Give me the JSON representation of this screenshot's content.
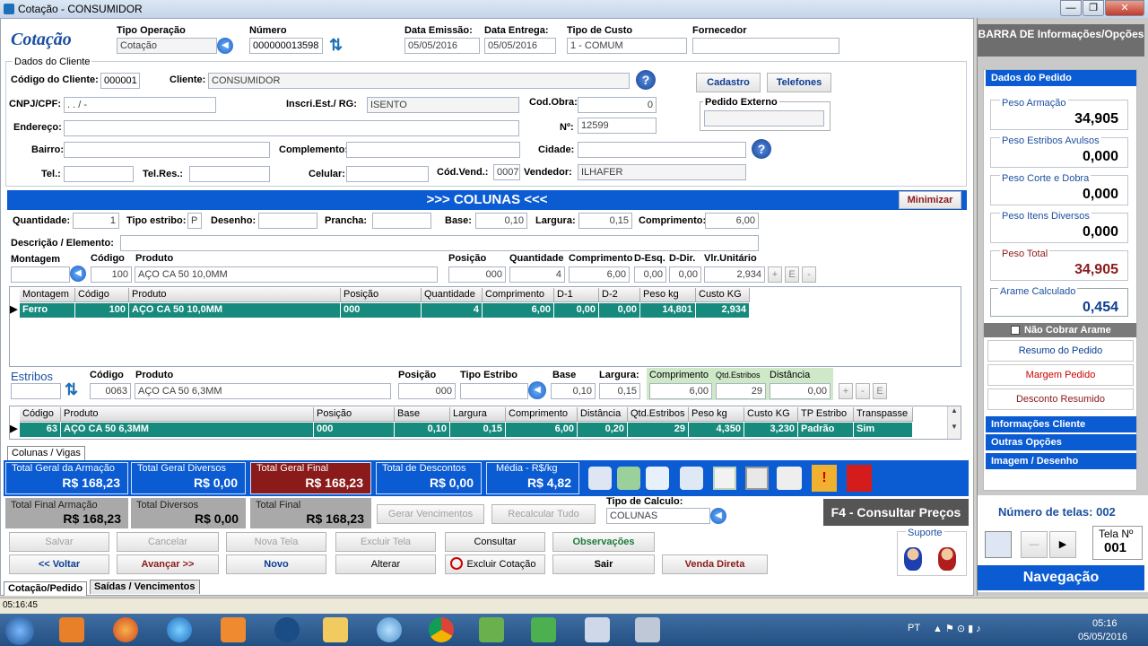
{
  "window": {
    "title": "Cotação - CONSUMIDOR"
  },
  "header": {
    "page_title": "Cotação",
    "tipo_operacao_label": "Tipo Operação",
    "tipo_operacao_value": "Cotação",
    "numero_label": "Número",
    "numero_value": "000000013598",
    "data_emissao_label": "Data Emissão:",
    "data_emissao_value": "05/05/2016",
    "data_entrega_label": "Data Entrega:",
    "data_entrega_value": "05/05/2016",
    "tipo_custo_label": "Tipo de Custo",
    "tipo_custo_value": "1 - COMUM",
    "fornecedor_label": "Fornecedor",
    "fornecedor_value": ""
  },
  "cliente": {
    "section_label": "Dados do Cliente",
    "codigo_label": "Código do Cliente:",
    "codigo_value": "000001",
    "cliente_label": "Cliente:",
    "cliente_value": "CONSUMIDOR",
    "cadastro_btn": "Cadastro",
    "telefones_btn": "Telefones",
    "cnpj_label": "CNPJ/CPF:",
    "cnpj_value": ".   .   /   -",
    "inscr_label": "Inscri.Est./ RG:",
    "inscr_value": "ISENTO",
    "codobra_label": "Cod.Obra:",
    "codobra_value": "0",
    "pedido_externo_label": "Pedido Externo",
    "endereco_label": "Endereço:",
    "n_label": "Nº:",
    "n_value": "12599",
    "bairro_label": "Bairro:",
    "complemento_label": "Complemento:",
    "cidade_label": "Cidade:",
    "tel_label": "Tel.:",
    "telres_label": "Tel.Res.:",
    "celular_label": "Celular:",
    "codvend_label": "Cód.Vend.:",
    "codvend_value": "0007",
    "vendedor_label": "Vendedor:",
    "vendedor_value": "ILHAFER"
  },
  "colunas": {
    "header": ">>> COLUNAS <<<",
    "minimizar_btn": "Minimizar",
    "quantidade_label": "Quantidade:",
    "quantidade_value": "1",
    "tipo_estribo_label": "Tipo estribo:",
    "tipo_estribo_value": "P",
    "desenho_label": "Desenho:",
    "prancha_label": "Prancha:",
    "base_label": "Base:",
    "base_value": "0,10",
    "largura_label": "Largura:",
    "largura_value": "0,15",
    "comprimento_label": "Comprimento:",
    "comprimento_value": "6,00",
    "descricao_label": "Descrição / Elemento:",
    "montagem_label": "Montagem",
    "codigo_label": "Código",
    "codigo_value": "100",
    "produto_label": "Produto",
    "produto_value": "AÇO CA 50 10,0MM",
    "posicao_label": "Posição",
    "posicao_value": "000",
    "qtd_label": "Quantidade",
    "qtd_value": "4",
    "comp_label": "Comprimento",
    "comp_value": "6,00",
    "desq_label": "D-Esq.",
    "desq_value": "0,00",
    "ddir_label": "D-Dir.",
    "ddir_value": "0,00",
    "vlr_label": "Vlr.Unitário",
    "vlr_value": "2,934"
  },
  "ferro_grid": {
    "headers": [
      "Montagem",
      "Código",
      "Produto",
      "Posição",
      "Quantidade",
      "Comprimento",
      "D-1",
      "D-2",
      "Peso kg",
      "Custo KG"
    ],
    "row": [
      "Ferro",
      "100",
      "AÇO CA 50 10,0MM",
      "000",
      "4",
      "6,00",
      "0,00",
      "0,00",
      "14,801",
      "2,934"
    ]
  },
  "estribos": {
    "estribos_label": "Estribos",
    "codigo_label": "Código",
    "codigo_value": "0063",
    "produto_label": "Produto",
    "produto_value": "AÇO CA 50 6,3MM",
    "posicao_label": "Posição",
    "posicao_value": "000",
    "tipo_label": "Tipo Estribo",
    "base_label": "Base",
    "base_value": "0,10",
    "largura_label": "Largura:",
    "largura_value": "0,15",
    "comprimento_label": "Comprimento",
    "comprimento_value": "6,00",
    "qtd_label": "Qtd.Estribos",
    "qtd_value": "29",
    "distancia_label": "Distância",
    "distancia_value": "0,00"
  },
  "estribos_grid": {
    "headers": [
      "Código",
      "Produto",
      "Posição",
      "Base",
      "Largura",
      "Comprimento",
      "Distância",
      "Qtd.Estribos",
      "Peso kg",
      "Custo KG",
      "TP Estribo",
      "Transpasse"
    ],
    "row": [
      "63",
      "AÇO CA 50 6,3MM",
      "000",
      "0,10",
      "0,15",
      "6,00",
      "0,20",
      "29",
      "4,350",
      "3,230",
      "Padrão",
      "Sim"
    ]
  },
  "tab_colunas": "Colunas / Vigas",
  "totais": {
    "armacao_label": "Total Geral da Armação",
    "armacao_value": "R$ 168,23",
    "diversos_label": "Total Geral Diversos",
    "diversos_value": "R$ 0,00",
    "final_label": "Total Geral Final",
    "final_value": "R$ 168,23",
    "descontos_label": "Total de Descontos",
    "descontos_value": "R$ 0,00",
    "media_label": "Média - R$/kg",
    "media_value": "R$ 4,82",
    "final_armacao_label": "Total Final Armação",
    "final_armacao_value": "R$ 168,23",
    "total_diversos_label": "Total Diversos",
    "total_diversos_value": "R$ 0,00",
    "total_final_label": "Total Final",
    "total_final_value": "R$ 168,23",
    "gerar_btn": "Gerar Vencimentos",
    "recalcular_btn": "Recalcular Tudo",
    "tipo_calculo_label": "Tipo de Calculo:",
    "tipo_calculo_value": "COLUNAS",
    "f4_label": "F4 - Consultar Preços"
  },
  "actions": {
    "salvar": "Salvar",
    "cancelar": "Cancelar",
    "nova_tela": "Nova Tela",
    "excluir_tela": "Excluir Tela",
    "consultar": "Consultar",
    "observacoes": "Observações",
    "voltar": "<< Voltar",
    "avancar": "Avançar >>",
    "novo": "Novo",
    "alterar": "Alterar",
    "excluir_cotacao": "Excluir Cotação",
    "sair": "Sair",
    "venda_direta": "Venda Direta",
    "suporte": "Suporte"
  },
  "bottom_tabs": {
    "cotacao": "Cotação/Pedido",
    "saidas": "Saídas / Vencimentos"
  },
  "status_time": "05:16:45",
  "sidebar": {
    "title": "BARRA DE Informações/Opções",
    "dados_pedido": "Dados do Pedido",
    "peso_armacao_label": "Peso Armação",
    "peso_armacao_value": "34,905",
    "peso_estribos_label": "Peso Estribos Avulsos",
    "peso_estribos_value": "0,000",
    "peso_corte_label": "Peso Corte e Dobra",
    "peso_corte_value": "0,000",
    "peso_itens_label": "Peso Itens Diversos",
    "peso_itens_value": "0,000",
    "peso_total_label": "Peso Total",
    "peso_total_value": "34,905",
    "arame_label": "Arame Calculado",
    "arame_value": "0,454",
    "nao_cobrar": "Não Cobrar Arame",
    "resumo_btn": "Resumo do Pedido",
    "margem_btn": "Margem Pedido",
    "desconto_btn": "Desconto Resumido",
    "info_cliente": "Informações Cliente",
    "outras_opcoes": "Outras Opções",
    "imagem_desenho": "Imagem / Desenho",
    "num_telas": "Número de telas: 002",
    "tela_label": "Tela Nº",
    "tela_value": "001",
    "navegacao": "Navegação"
  },
  "taskbar": {
    "lang": "PT",
    "time": "05:16",
    "date": "05/05/2016"
  },
  "colors": {
    "accent": "#0b5bd3",
    "teal_row": "#178a7e",
    "red_total": "#8b1a1a"
  }
}
